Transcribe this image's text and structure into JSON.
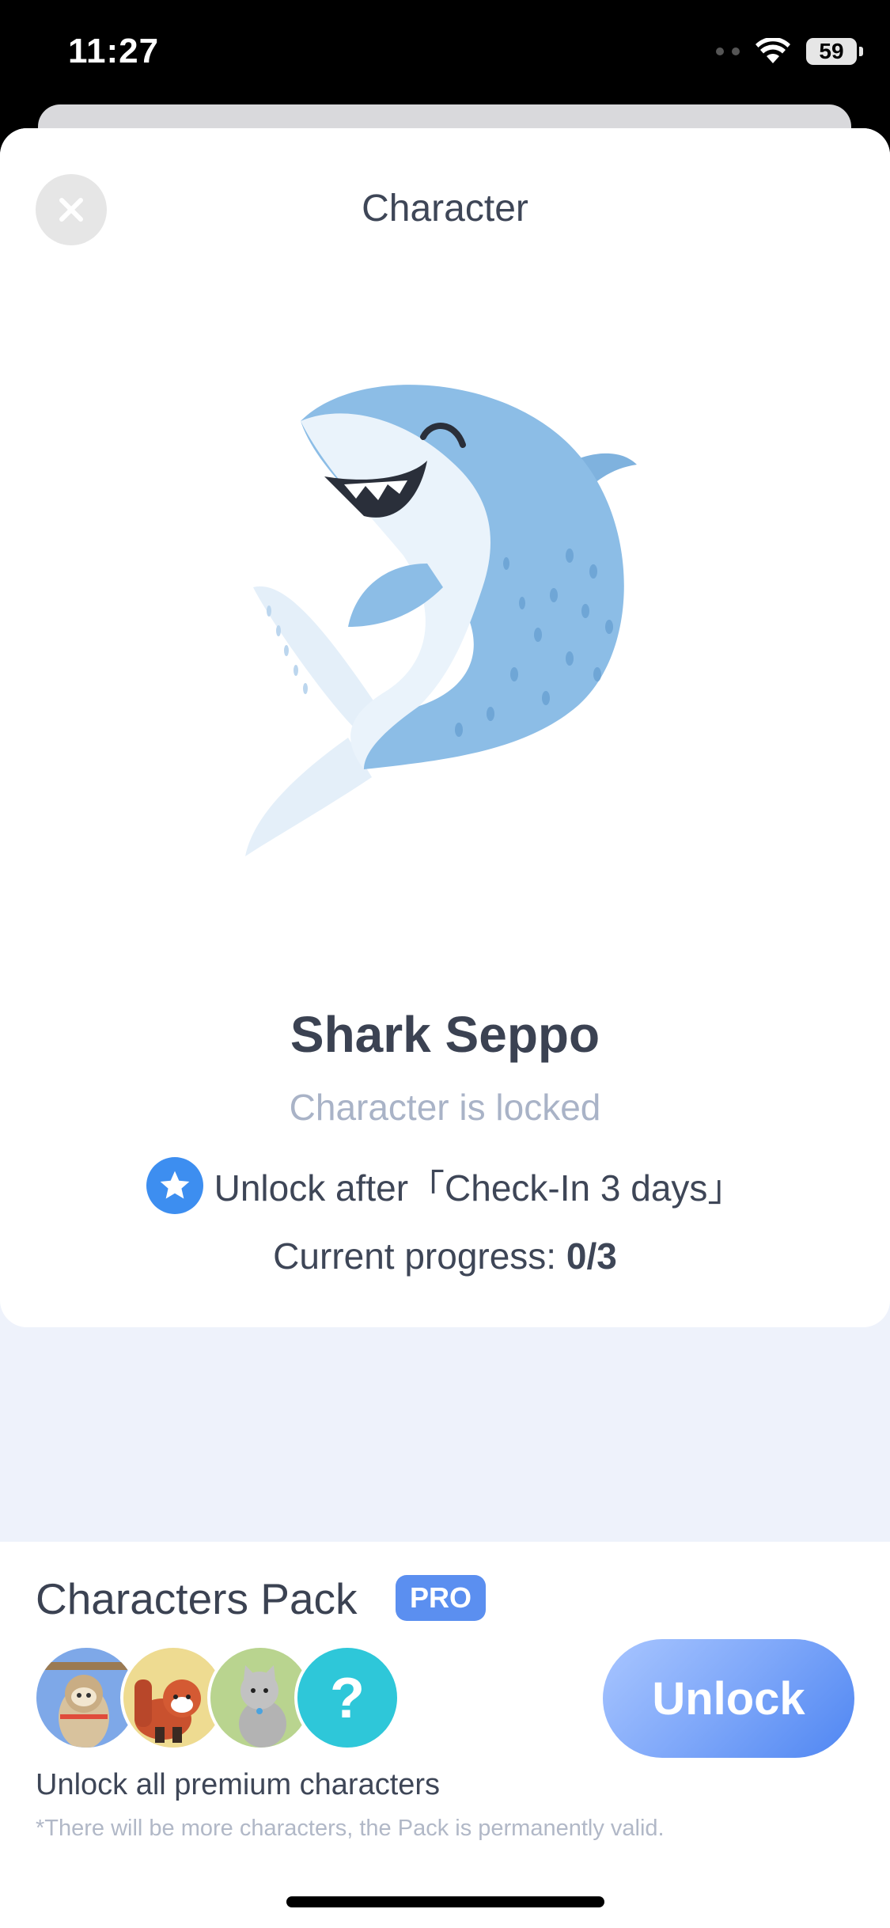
{
  "status_bar": {
    "time": "11:27",
    "battery": "59"
  },
  "header": {
    "title": "Character"
  },
  "character": {
    "name": "Shark Seppo",
    "status": "Character is locked",
    "unlock_condition": "Unlock after「Check-In 3 days」",
    "progress_label": "Current progress: ",
    "progress_value": "0/3"
  },
  "pack": {
    "title": "Characters Pack",
    "badge": "PRO",
    "avatars": [
      "sloth",
      "red-panda",
      "cat",
      "mystery"
    ],
    "unlock_label": "Unlock",
    "description": "Unlock all premium characters",
    "note": "*There will be more characters, the Pack is permanently valid."
  },
  "colors": {
    "accent": "#4f86f2",
    "badge": "#5b8ff0",
    "star": "#3d8ef0",
    "muted": "#a9b3c7"
  }
}
